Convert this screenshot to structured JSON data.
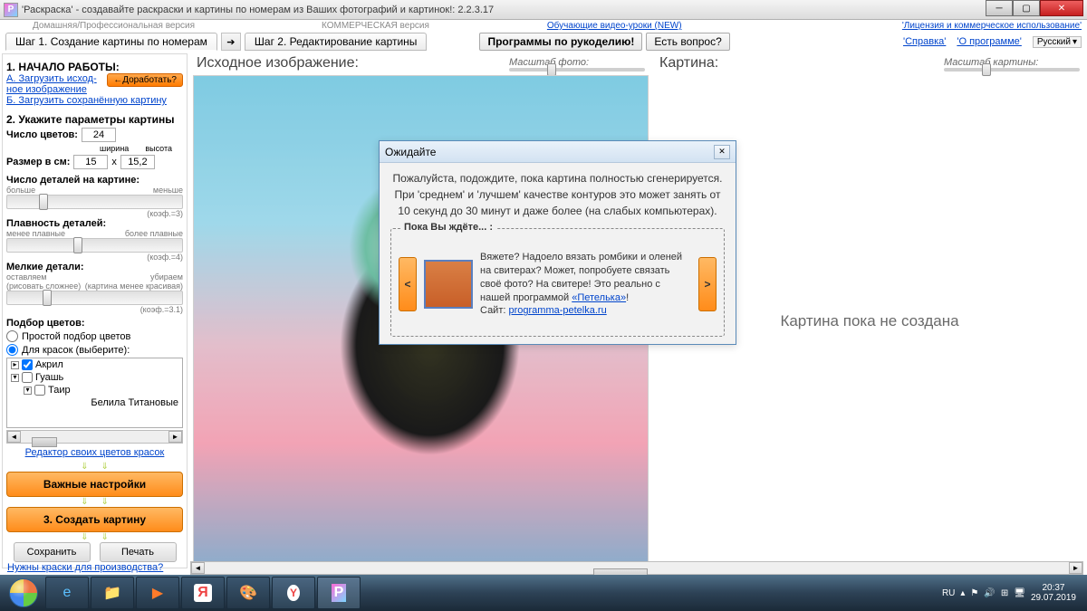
{
  "titlebar": {
    "icon_letter": "P",
    "title": "'Раскраска' - создавайте раскраски и картины по номерам из Ваших фотографий и картинок!: 2.2.3.17"
  },
  "toprow": {
    "home_pro": "Домашняя/Профессиональная версия",
    "commercial": "КОММЕРЧЕСКАЯ версия",
    "video_lessons": "Обучающие видео-уроки (NEW)",
    "license": "'Лицензия и коммерческое использование'",
    "help": "'Справка'",
    "about": "'О программе'",
    "lang": "Русский"
  },
  "tabs": {
    "step1": "Шаг 1. Создание картины по номерам",
    "step2": "Шаг 2. Редактирование картины",
    "crafts": "Программы по рукоделию!",
    "question": "Есть вопрос?"
  },
  "left": {
    "start_heading": "1. НАЧАЛО РАБОТЫ:",
    "link_a": "А. Загрузить исход-\nное изображение",
    "link_b": "Б. Загрузить сохранённую картину",
    "refine": "←Доработать?",
    "params_heading": "2. Укажите параметры картины",
    "colors_label": "Число цветов:",
    "colors_value": "24",
    "size_label": "Размер в см:",
    "width_label": "ширина",
    "height_label": "высота",
    "width_value": "15",
    "x": "x",
    "height_value": "15,2",
    "details_label": "Число деталей на картине:",
    "details_left": "больше",
    "details_right": "меньше",
    "coef3": "(коэф.=3)",
    "smooth_label": "Плавность деталей:",
    "smooth_left": "менее плавные",
    "smooth_right": "более плавные",
    "coef4": "(коэф.=4)",
    "small_label": "Мелкие детали:",
    "small_left": "оставляем",
    "small_left2": "(рисовать сложнее)",
    "small_right": "убираем",
    "small_right2": "(картина менее красивая)",
    "coef31": "(коэф.=3.1)",
    "colorsel_heading": "Подбор цветов:",
    "radio_simple": "Простой подбор цветов",
    "radio_paints": "Для красок (выберите):",
    "tree_acrylic": "Акрил",
    "tree_gouache": "Гуашь",
    "tree_tair": "Таир",
    "tree_white": "Белила Титановые",
    "editor_link": "Редактор своих цветов красок",
    "important_btn": "Важные настройки",
    "create_btn": "3. Создать картину",
    "save_btn": "Сохранить",
    "print_btn": "Печать"
  },
  "center": {
    "heading": "Исходное изображение:",
    "zoom_label": "Масштаб фото:"
  },
  "right": {
    "heading": "Картина:",
    "zoom_label": "Масштаб картины:",
    "placeholder": "Картина пока не создана"
  },
  "modal": {
    "title": "Ожидайте",
    "wait_text": "Пожалуйста, подождите, пока картина полностью сгенерируется. При 'среднем' и 'лучшем' качестве контуров это может занять от 10 секунд до 30 минут и даже более (на слабых компьютерах).",
    "legend": "Пока Вы ждёте... :",
    "promo_text": "Вяжете? Надоело вязать ромбики и оленей на свитерах? Может, попробуете связать своё фото? На свитере! Это реально с нашей программой ",
    "promo_link1": "«Петелька»",
    "promo_text2": "!",
    "promo_site_label": "Сайт: ",
    "promo_site": "programma-petelka.ru"
  },
  "bottom_link": "Нужны краски для производства?",
  "taskbar": {
    "lang": "RU",
    "time": "20:37",
    "date": "29.07.2019"
  }
}
